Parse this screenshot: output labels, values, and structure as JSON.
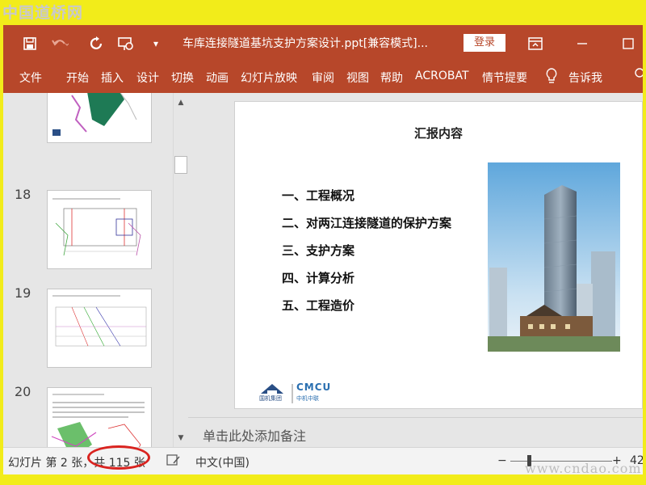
{
  "watermark": {
    "top": "中国道桥网",
    "bottom": "www.cndao.com"
  },
  "titlebar": {
    "title": "车库连接隧道基坑支护方案设计.ppt[兼容模式]...",
    "login": "登录",
    "icons": [
      "save-icon",
      "undo-icon",
      "redo-icon",
      "present-icon",
      "customize-icon",
      "ribbon-display-icon",
      "minimize-icon",
      "maximize-icon"
    ]
  },
  "ribbon": {
    "tabs": [
      "文件",
      "开始",
      "插入",
      "设计",
      "切换",
      "动画",
      "幻灯片放映",
      "审阅",
      "视图",
      "帮助",
      "ACROBAT",
      "情节提要"
    ],
    "tell_me": "告诉我"
  },
  "thumbnails": {
    "numbers": [
      "18",
      "19",
      "20"
    ]
  },
  "slide": {
    "title": "汇报内容",
    "agenda": [
      "一、工程概况",
      "二、对两江连接隧道的保护方案",
      "三、支护方案",
      "四、计算分析",
      "五、工程造价"
    ],
    "logo_left_label": "国机集团",
    "logo_right_label": "CMCU",
    "logo_right_sub": "中机中联"
  },
  "notes": {
    "placeholder": "单击此处添加备注"
  },
  "statusbar": {
    "slide_info": "幻灯片 第 2 张，共 115 张",
    "language": "中文(中国)",
    "zoom_minus": "−",
    "zoom_plus": "+",
    "zoom_value": "42",
    "zoom_level": 0.42
  },
  "colors": {
    "accent": "#b7472a",
    "highlight_circle": "#d9231f",
    "background": "#f2ec1a"
  }
}
